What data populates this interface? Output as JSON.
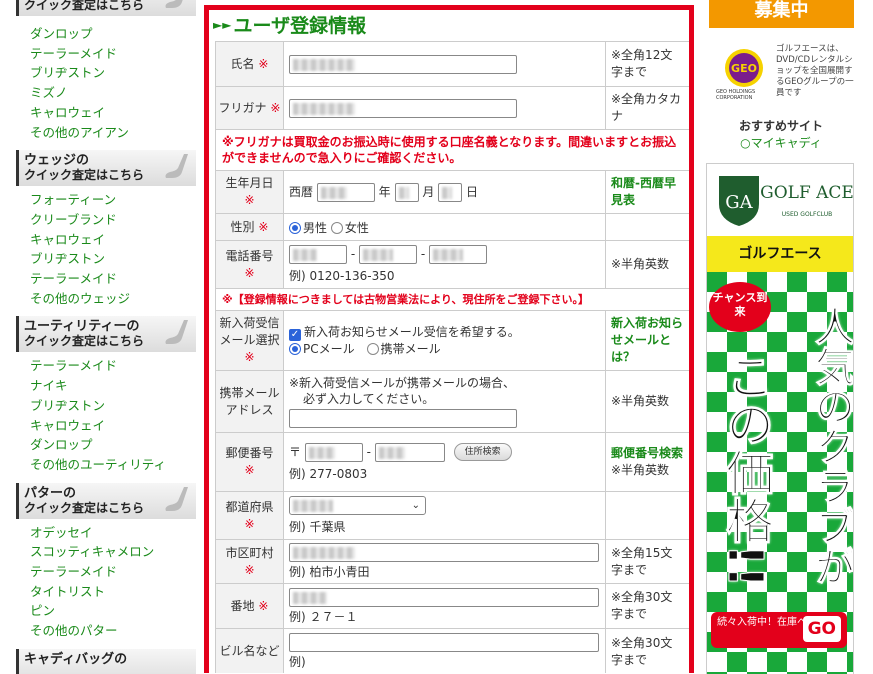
{
  "sidebar": {
    "top_partial_category": "クイック査定はこちら",
    "iron_links": [
      "ダンロップ",
      "テーラーメイド",
      "ブリヂストン",
      "ミズノ",
      "キャロウェイ",
      "その他のアイアン"
    ],
    "wedge": {
      "title": "ウェッジの",
      "subtitle": "クイック査定はこちら",
      "links": [
        "フォーティーン",
        "クリーブランド",
        "キャロウェイ",
        "ブリヂストン",
        "テーラーメイド",
        "その他のウェッジ"
      ]
    },
    "utility": {
      "title": "ユーティリティーの",
      "subtitle": "クイック査定はこちら",
      "links": [
        "テーラーメイド",
        "ナイキ",
        "ブリヂストン",
        "キャロウェイ",
        "ダンロップ",
        "その他のユーティリティ"
      ]
    },
    "putter": {
      "title": "パターの",
      "subtitle": "クイック査定はこちら",
      "links": [
        "オデッセイ",
        "スコッティキャメロン",
        "テーラーメイド",
        "タイトリスト",
        "ピン",
        "その他のパター"
      ]
    },
    "caddy_partial": "キャディバッグの"
  },
  "form": {
    "section_title": "ユーザ登録情報",
    "section_arrow": "►►",
    "required_mark": "※",
    "rows": {
      "name": {
        "label": "氏名",
        "note": "※全角12文字まで"
      },
      "furigana": {
        "label": "フリガナ",
        "note": "※全角カタカナ"
      },
      "furigana_warning": "※フリガナは買取金のお振込時に使用する口座名義となります。間違いますとお振込ができませんので急入りにご確認ください。",
      "birth": {
        "label": "生年月日",
        "era": "西暦",
        "year": "年",
        "month": "月",
        "day": "日",
        "note": "和暦-西暦早見表"
      },
      "gender": {
        "label": "性別",
        "male": "男性",
        "female": "女性"
      },
      "phone": {
        "label": "電話番号",
        "sep": "-",
        "example": "例) 0120-136-350",
        "note": "※半角英数"
      },
      "law_notice": "※【登録情報につきましては古物営業法により、現住所をご登録下さい。】",
      "mail_select": {
        "label": "新入荷受信メール選択",
        "checkbox": "新入荷お知らせメール受信を希望する。",
        "pc": "PCメール",
        "mobile": "携帯メール",
        "note": "新入荷お知らせメールとは？"
      },
      "mobile_mail": {
        "label": "携帯メールアドレス",
        "desc1": "※新入荷受信メールが携帯メールの場合、",
        "desc2": "必ず入力してください。",
        "note": "※半角英数"
      },
      "postal": {
        "label": "郵便番号",
        "prefix": "〒",
        "sep": "-",
        "button": "住所検索",
        "example": "例) 277-0803",
        "note_link": "郵便番号検索",
        "note": "※半角英数"
      },
      "prefecture": {
        "label": "都道府県",
        "example": "例) 千葉県"
      },
      "city": {
        "label": "市区町村",
        "example": "例) 柏市小青田",
        "note": "※全角15文字まで"
      },
      "address": {
        "label": "番地",
        "example": "例) ２７－１",
        "note": "※全角30文字まで"
      },
      "building": {
        "label": "ビル名など",
        "example": "例)",
        "note": "※全角30文字まで"
      }
    }
  },
  "right": {
    "recruit": "募集中",
    "geo_text": "ゴルフエースは、DVD/CDレンタルショップを全国展開するGEOグループの一員です",
    "geo_caption": "GEO HOLDINGS CORPORATION",
    "recommend_title": "おすすめサイト",
    "recommend_link": "○マイキャディ",
    "banner": {
      "logo_text": "GOLF ACE",
      "logo_sub": "USED GOLFCLUB",
      "bar": "ゴルフエース",
      "burst": "チャンス到来",
      "headline": "人気のクラブがこの価格!!",
      "cta_text": "続々入荷中！在庫へ",
      "cta_go": "GO"
    }
  }
}
